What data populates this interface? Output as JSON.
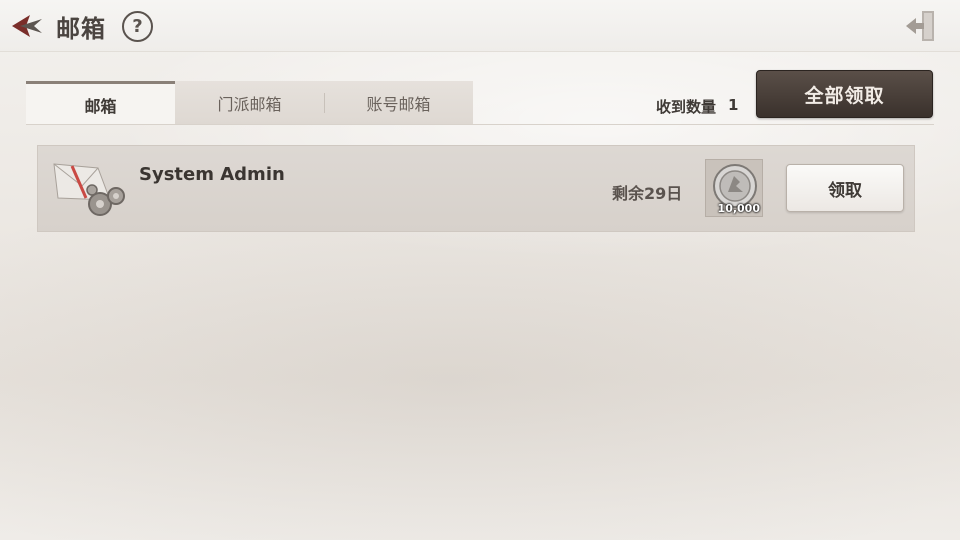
{
  "header": {
    "title": "邮箱",
    "help_glyph": "?",
    "back_icon": "back-arrow-icon",
    "exit_icon": "exit-icon"
  },
  "tabs": [
    {
      "label": "邮箱",
      "active": true
    },
    {
      "label": "门派邮箱",
      "active": false
    },
    {
      "label": "账号邮箱",
      "active": false
    }
  ],
  "summary": {
    "count_label": "收到数量",
    "count_value": "1",
    "claim_all_label": "全部领取"
  },
  "mails": [
    {
      "sender": "System Admin",
      "remaining": "剩余29日",
      "icon": "system-mail-icon",
      "reward": {
        "icon": "silver-coin-icon",
        "amount": "10,000"
      },
      "claim_label": "领取"
    }
  ],
  "colors": {
    "accent_dark": "#3a312c",
    "text_primary": "#3f3a36",
    "row_bg": "#d9d3cd"
  }
}
